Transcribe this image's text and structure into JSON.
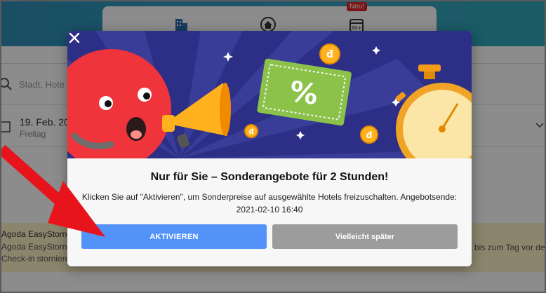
{
  "background": {
    "tab_badge": "Neu!",
    "search_placeholder": "Stadt, Hote",
    "date": {
      "value": "19. Feb. 202",
      "weekday": "Freitag"
    },
    "easystorno": {
      "title": "Agoda EasyStorno",
      "line1": "Agoda EasyStorno",
      "line2": "Check-in storniere",
      "right_text": "bis zum Tag vor dem"
    }
  },
  "modal": {
    "title": "Nur für Sie – Sonderangebote für 2 Stunden!",
    "text": "Klicken Sie auf \"Aktivieren\", um Sonderpreise auf ausgewählte Hotels freizuschalten. Angebotsende: 2021-02-10 16:40",
    "activate_label": "AKTIVIEREN",
    "later_label": "Vielleicht später",
    "coupon_symbol": "%",
    "colors": {
      "hero_bg": "#2d2f86",
      "primary": "#5392f9",
      "secondary": "#9c9c9c",
      "annotation_arrow": "#e8141b"
    }
  }
}
